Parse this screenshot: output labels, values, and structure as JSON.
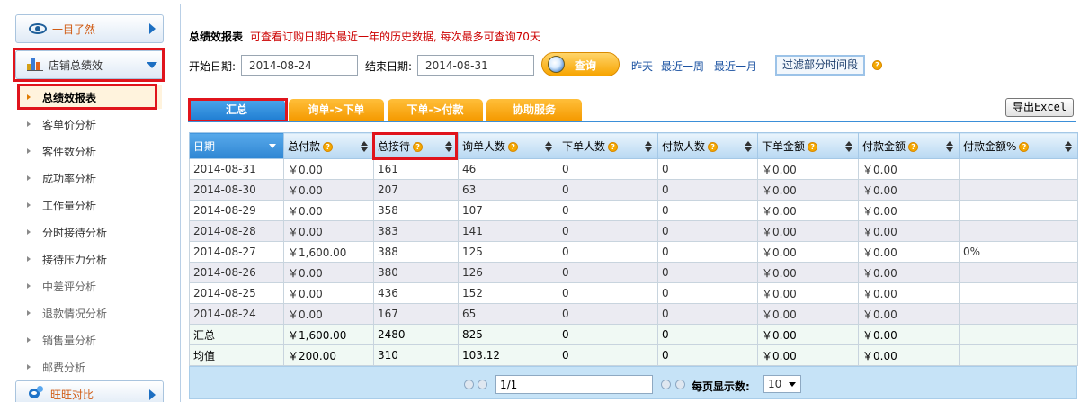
{
  "sidebar": {
    "overview_label": "一目了然",
    "store_perf_label": "店铺总绩效",
    "items": [
      {
        "label": "总绩效报表"
      },
      {
        "label": "客单价分析"
      },
      {
        "label": "客件数分析"
      },
      {
        "label": "成功率分析"
      },
      {
        "label": "工作量分析"
      },
      {
        "label": "分时接待分析"
      },
      {
        "label": "接待压力分析"
      },
      {
        "label": "中差评分析"
      },
      {
        "label": "退款情况分析"
      },
      {
        "label": "销售量分析"
      },
      {
        "label": "邮费分析"
      }
    ],
    "wangwang_label": "旺旺对比"
  },
  "report": {
    "title": "总绩效报表",
    "note": "可查看订购日期内最近一年的历史数据, 每次最多可查询70天"
  },
  "filter": {
    "start_label": "开始日期:",
    "start_value": "2014-08-24",
    "end_label": "结束日期:",
    "end_value": "2014-08-31",
    "query_label": "查询",
    "yesterday": "昨天",
    "last_week": "最近一周",
    "last_month": "最近一月",
    "time_slot_label": "过滤部分时间段"
  },
  "tabs": [
    {
      "label": "汇总"
    },
    {
      "label": "询单->下单"
    },
    {
      "label": "下单->付款"
    },
    {
      "label": "协助服务"
    }
  ],
  "export_label": "导出Excel",
  "table": {
    "headers": [
      "日期",
      "总付款",
      "总接待",
      "询单人数",
      "下单人数",
      "付款人数",
      "下单金额",
      "付款金额",
      "付款金额%"
    ],
    "rows": [
      [
        "2014-08-31",
        "￥0.00",
        "161",
        "46",
        "0",
        "0",
        "￥0.00",
        "￥0.00",
        ""
      ],
      [
        "2014-08-30",
        "￥0.00",
        "207",
        "63",
        "0",
        "0",
        "￥0.00",
        "￥0.00",
        ""
      ],
      [
        "2014-08-29",
        "￥0.00",
        "358",
        "107",
        "0",
        "0",
        "￥0.00",
        "￥0.00",
        ""
      ],
      [
        "2014-08-28",
        "￥0.00",
        "383",
        "141",
        "0",
        "0",
        "￥0.00",
        "￥0.00",
        ""
      ],
      [
        "2014-08-27",
        "￥1,600.00",
        "388",
        "125",
        "0",
        "0",
        "￥0.00",
        "￥0.00",
        "0%"
      ],
      [
        "2014-08-26",
        "￥0.00",
        "380",
        "126",
        "0",
        "0",
        "￥0.00",
        "￥0.00",
        ""
      ],
      [
        "2014-08-25",
        "￥0.00",
        "436",
        "152",
        "0",
        "0",
        "￥0.00",
        "￥0.00",
        ""
      ],
      [
        "2014-08-24",
        "￥0.00",
        "167",
        "65",
        "0",
        "0",
        "￥0.00",
        "￥0.00",
        ""
      ]
    ],
    "summary_rows": [
      [
        "汇总",
        "￥1,600.00",
        "2480",
        "825",
        "0",
        "0",
        "￥0.00",
        "￥0.00",
        ""
      ],
      [
        "均值",
        "￥200.00",
        "310",
        "103.12",
        "0",
        "0",
        "￥0.00",
        "￥0.00",
        ""
      ]
    ]
  },
  "pager": {
    "page_value": "1/1",
    "per_page_label": "每页显示数:",
    "per_page_value": "10"
  },
  "colors": {
    "highlight_box": "#e0141c",
    "tab_active": "#2a8ad8",
    "tab_inactive": "#f7a600"
  }
}
